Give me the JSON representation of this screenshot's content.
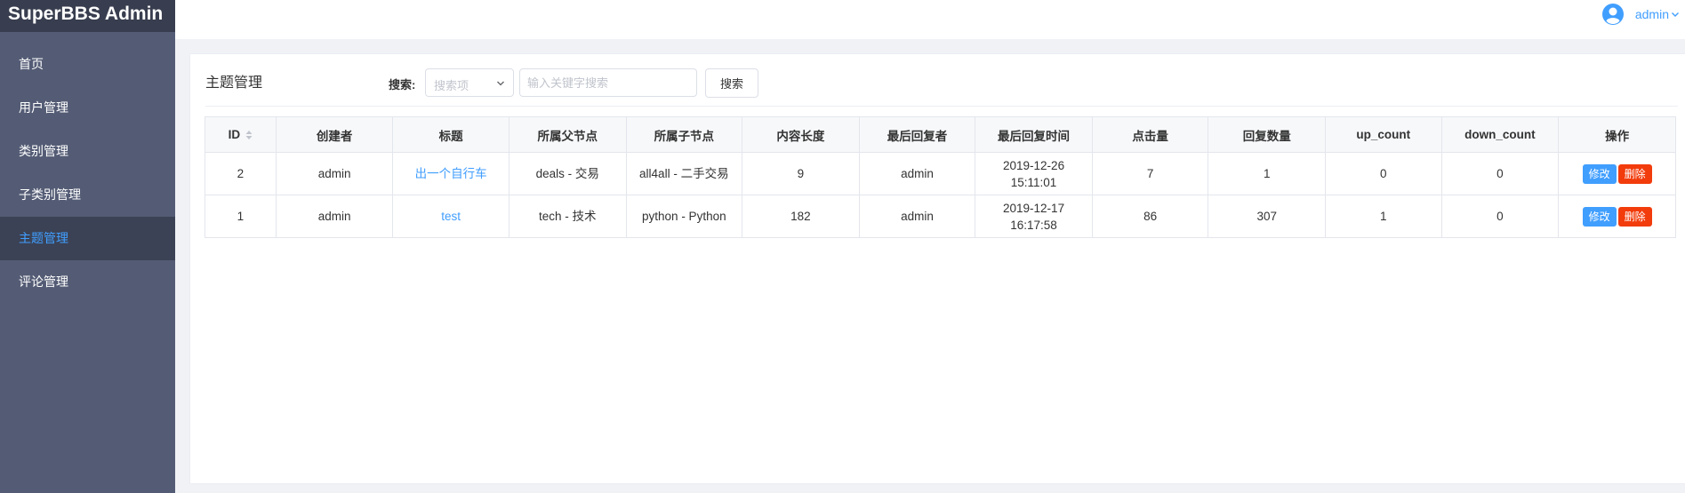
{
  "brand": "SuperBBS Admin",
  "user": {
    "name": "admin"
  },
  "sidebar": {
    "items": [
      {
        "label": "首页",
        "name": "sidebar-item-home"
      },
      {
        "label": "用户管理",
        "name": "sidebar-item-users"
      },
      {
        "label": "类别管理",
        "name": "sidebar-item-categories"
      },
      {
        "label": "子类别管理",
        "name": "sidebar-item-subcategories"
      },
      {
        "label": "主题管理",
        "name": "sidebar-item-topics"
      },
      {
        "label": "评论管理",
        "name": "sidebar-item-comments"
      }
    ],
    "active_index": 4
  },
  "page": {
    "title": "主题管理",
    "search_label": "搜索:",
    "select_placeholder": "搜索项",
    "input_placeholder": "输入关键字搜索",
    "search_button": "搜索"
  },
  "table": {
    "columns": [
      "ID",
      "创建者",
      "标题",
      "所属父节点",
      "所属子节点",
      "内容长度",
      "最后回复者",
      "最后回复时间",
      "点击量",
      "回复数量",
      "up_count",
      "down_count",
      "操作"
    ],
    "rows": [
      {
        "id": "2",
        "creator": "admin",
        "title": "出一个自行车",
        "parent": "deals - 交易",
        "child": "all4all - 二手交易",
        "length": "9",
        "last_replier": "admin",
        "last_reply_time": "2019-12-26 15:11:01",
        "clicks": "7",
        "replies": "1",
        "up": "0",
        "down": "0"
      },
      {
        "id": "1",
        "creator": "admin",
        "title": "test",
        "parent": "tech - 技术",
        "child": "python - Python",
        "length": "182",
        "last_replier": "admin",
        "last_reply_time": "2019-12-17 16:17:58",
        "clicks": "86",
        "replies": "307",
        "up": "1",
        "down": "0"
      }
    ],
    "edit_label": "修改",
    "delete_label": "删除"
  },
  "colors": {
    "sidebar_bg": "#545c75",
    "accent": "#409eff",
    "danger": "#f23c0c"
  },
  "icons": {
    "user": "user-circle-icon",
    "caret": "chevron-down-icon",
    "sort": "sort-icon"
  }
}
